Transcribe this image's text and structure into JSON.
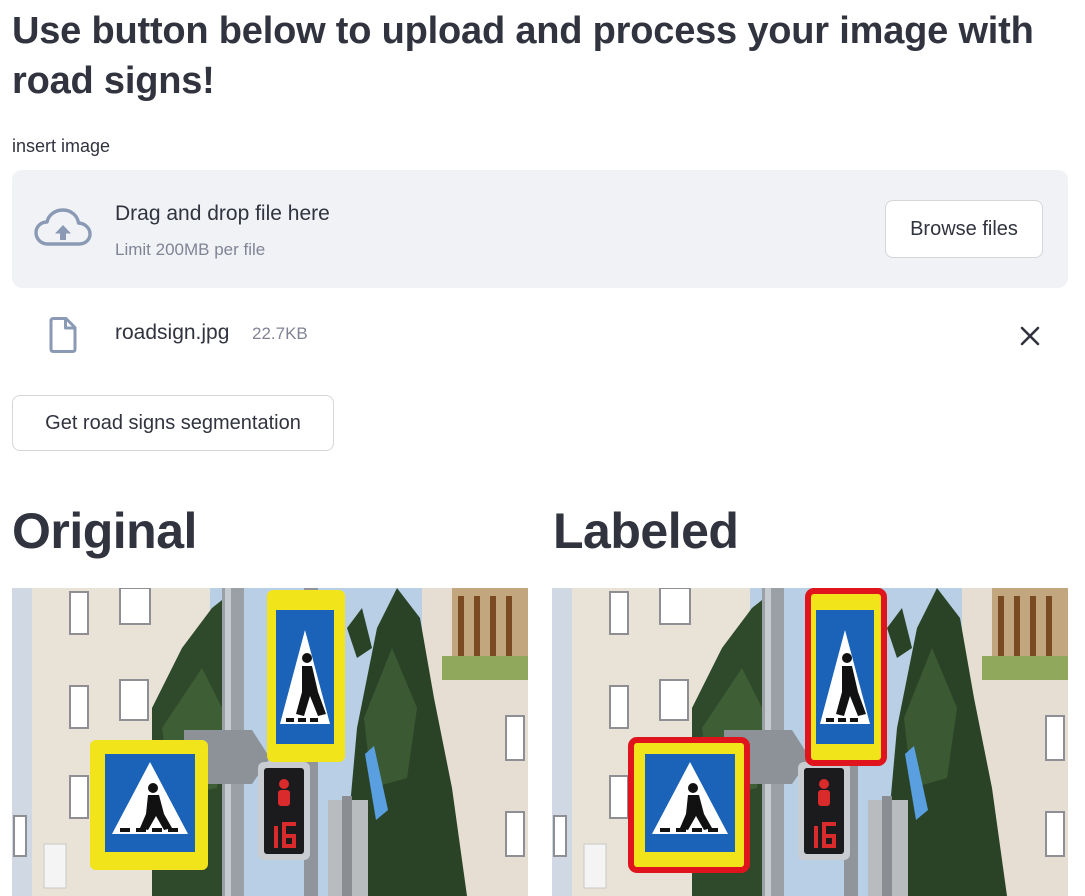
{
  "header": {
    "title": "Use button below to upload and process your image with road signs!"
  },
  "uploader": {
    "label": "insert image",
    "dropzone_text": "Drag and drop file here",
    "limit_text": "Limit 200MB per file",
    "browse_label": "Browse files",
    "cloud_icon": "cloud-upload-icon"
  },
  "uploaded_file": {
    "name": "roadsign.jpg",
    "size": "22.7KB",
    "file_icon": "file-icon",
    "remove_icon": "close-icon"
  },
  "action": {
    "segment_label": "Get road signs segmentation"
  },
  "columns": {
    "original_heading": "Original",
    "labeled_heading": "Labeled"
  },
  "colors": {
    "text": "#31333f",
    "muted": "#808495",
    "dropzone_bg": "#f0f2f6",
    "border": "#d6d6d9",
    "sign_yellow": "#f2e41b",
    "sign_blue": "#1a63b8",
    "label_box_red": "#e0141c"
  }
}
